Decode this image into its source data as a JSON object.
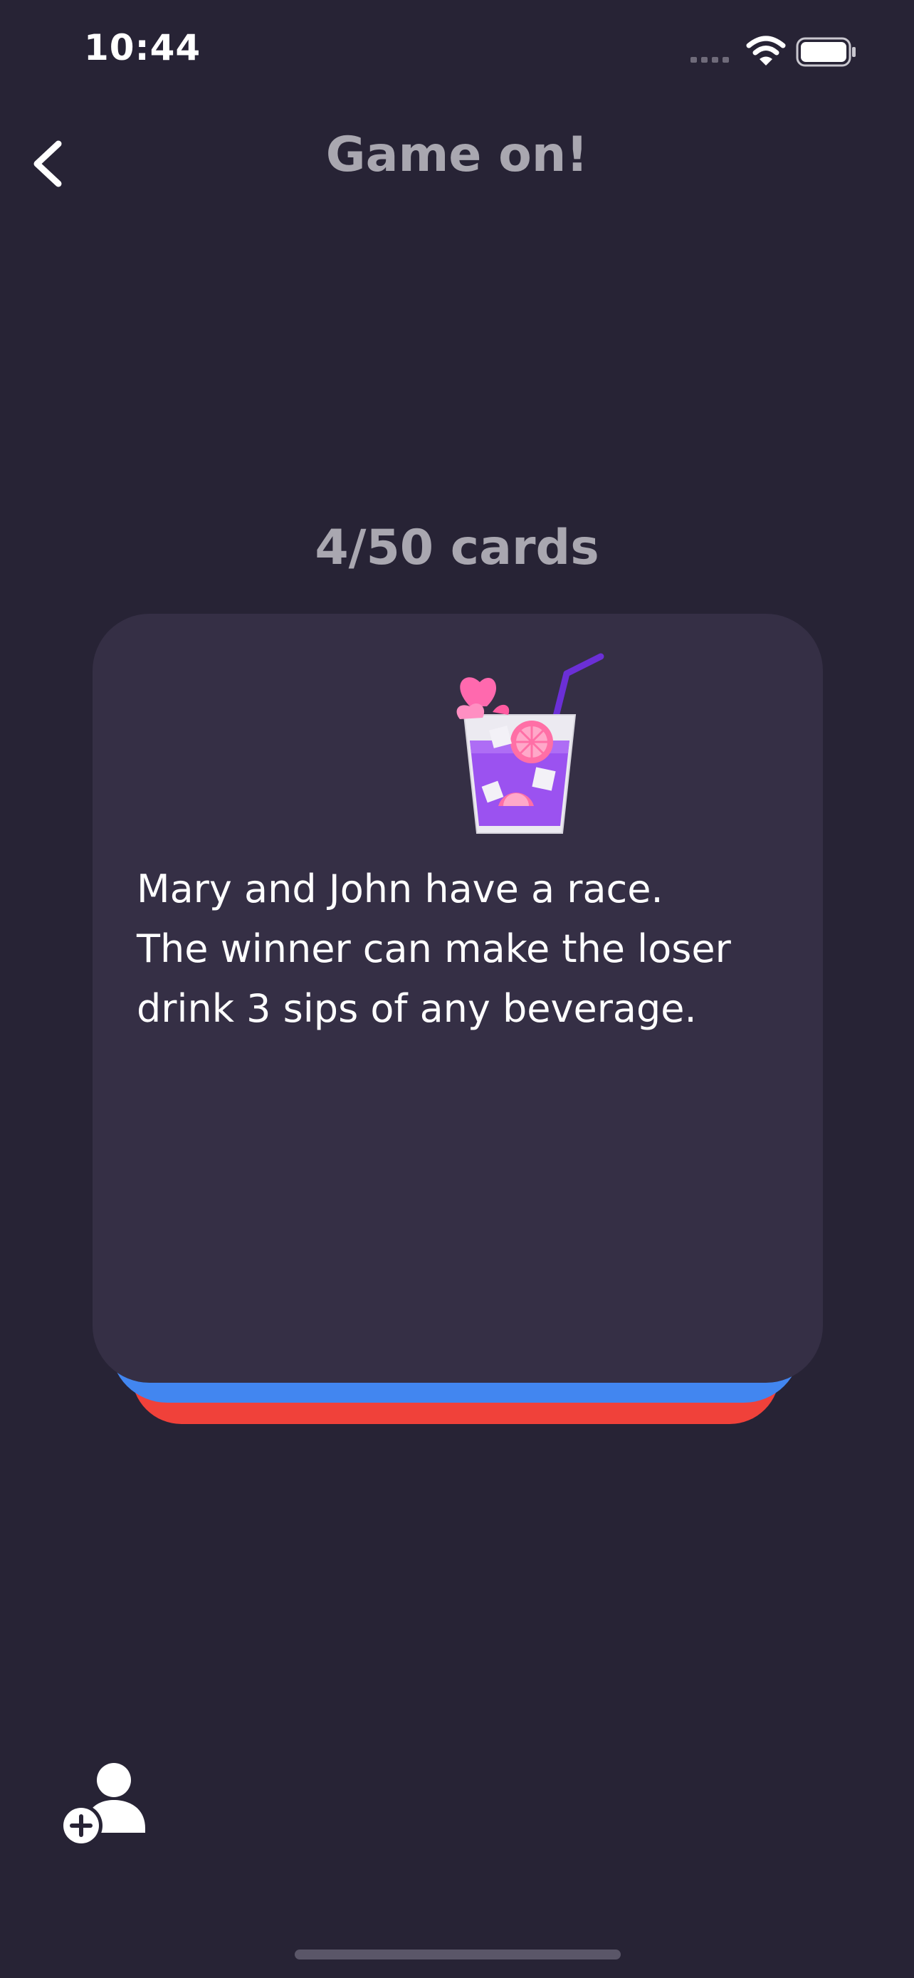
{
  "status_bar": {
    "time": "10:44",
    "icons": [
      "cellular-signal-icon",
      "wifi-icon",
      "battery-icon"
    ]
  },
  "header": {
    "back_icon": "chevron-left-icon",
    "title": "Game on!"
  },
  "game": {
    "counter": "4/50 cards",
    "card": {
      "illustration": "cocktail-glass-icon",
      "prompt": "Mary  and John have a race.\nThe winner can make the loser\ndrink 3 sips of any beverage."
    },
    "stack_colors": [
      "#4286f0",
      "#f0413a"
    ]
  },
  "footer": {
    "add_player_icon": "add-player-icon"
  },
  "colors": {
    "background": "#272335",
    "card": "#352f45",
    "muted_text": "#a9a7b0"
  }
}
